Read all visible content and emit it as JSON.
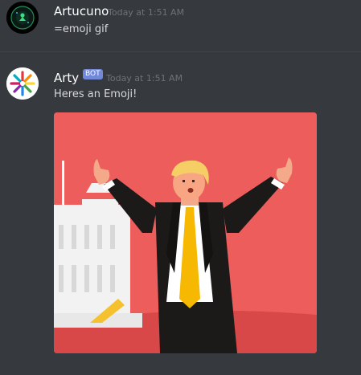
{
  "messages": [
    {
      "author": "Artucuno",
      "timestamp": "Today at 1:51 AM",
      "content": "=emoji gif",
      "avatar_icon": "dark-circle-logo-icon"
    },
    {
      "author": "Arty",
      "badge": "BOT",
      "timestamp": "Today at 1:51 AM",
      "content": "Heres an Emoji!",
      "avatar_icon": "colorful-arrows-logo-icon",
      "attachment_icon": "thumbs-up-man-gif-icon"
    }
  ],
  "colors": {
    "background": "#36393e",
    "author": "#ffffff",
    "timestamp": "#6e7176",
    "text": "#d7d8d9",
    "bot_badge": "#7289da",
    "gif_background": "#ec5d5c"
  }
}
